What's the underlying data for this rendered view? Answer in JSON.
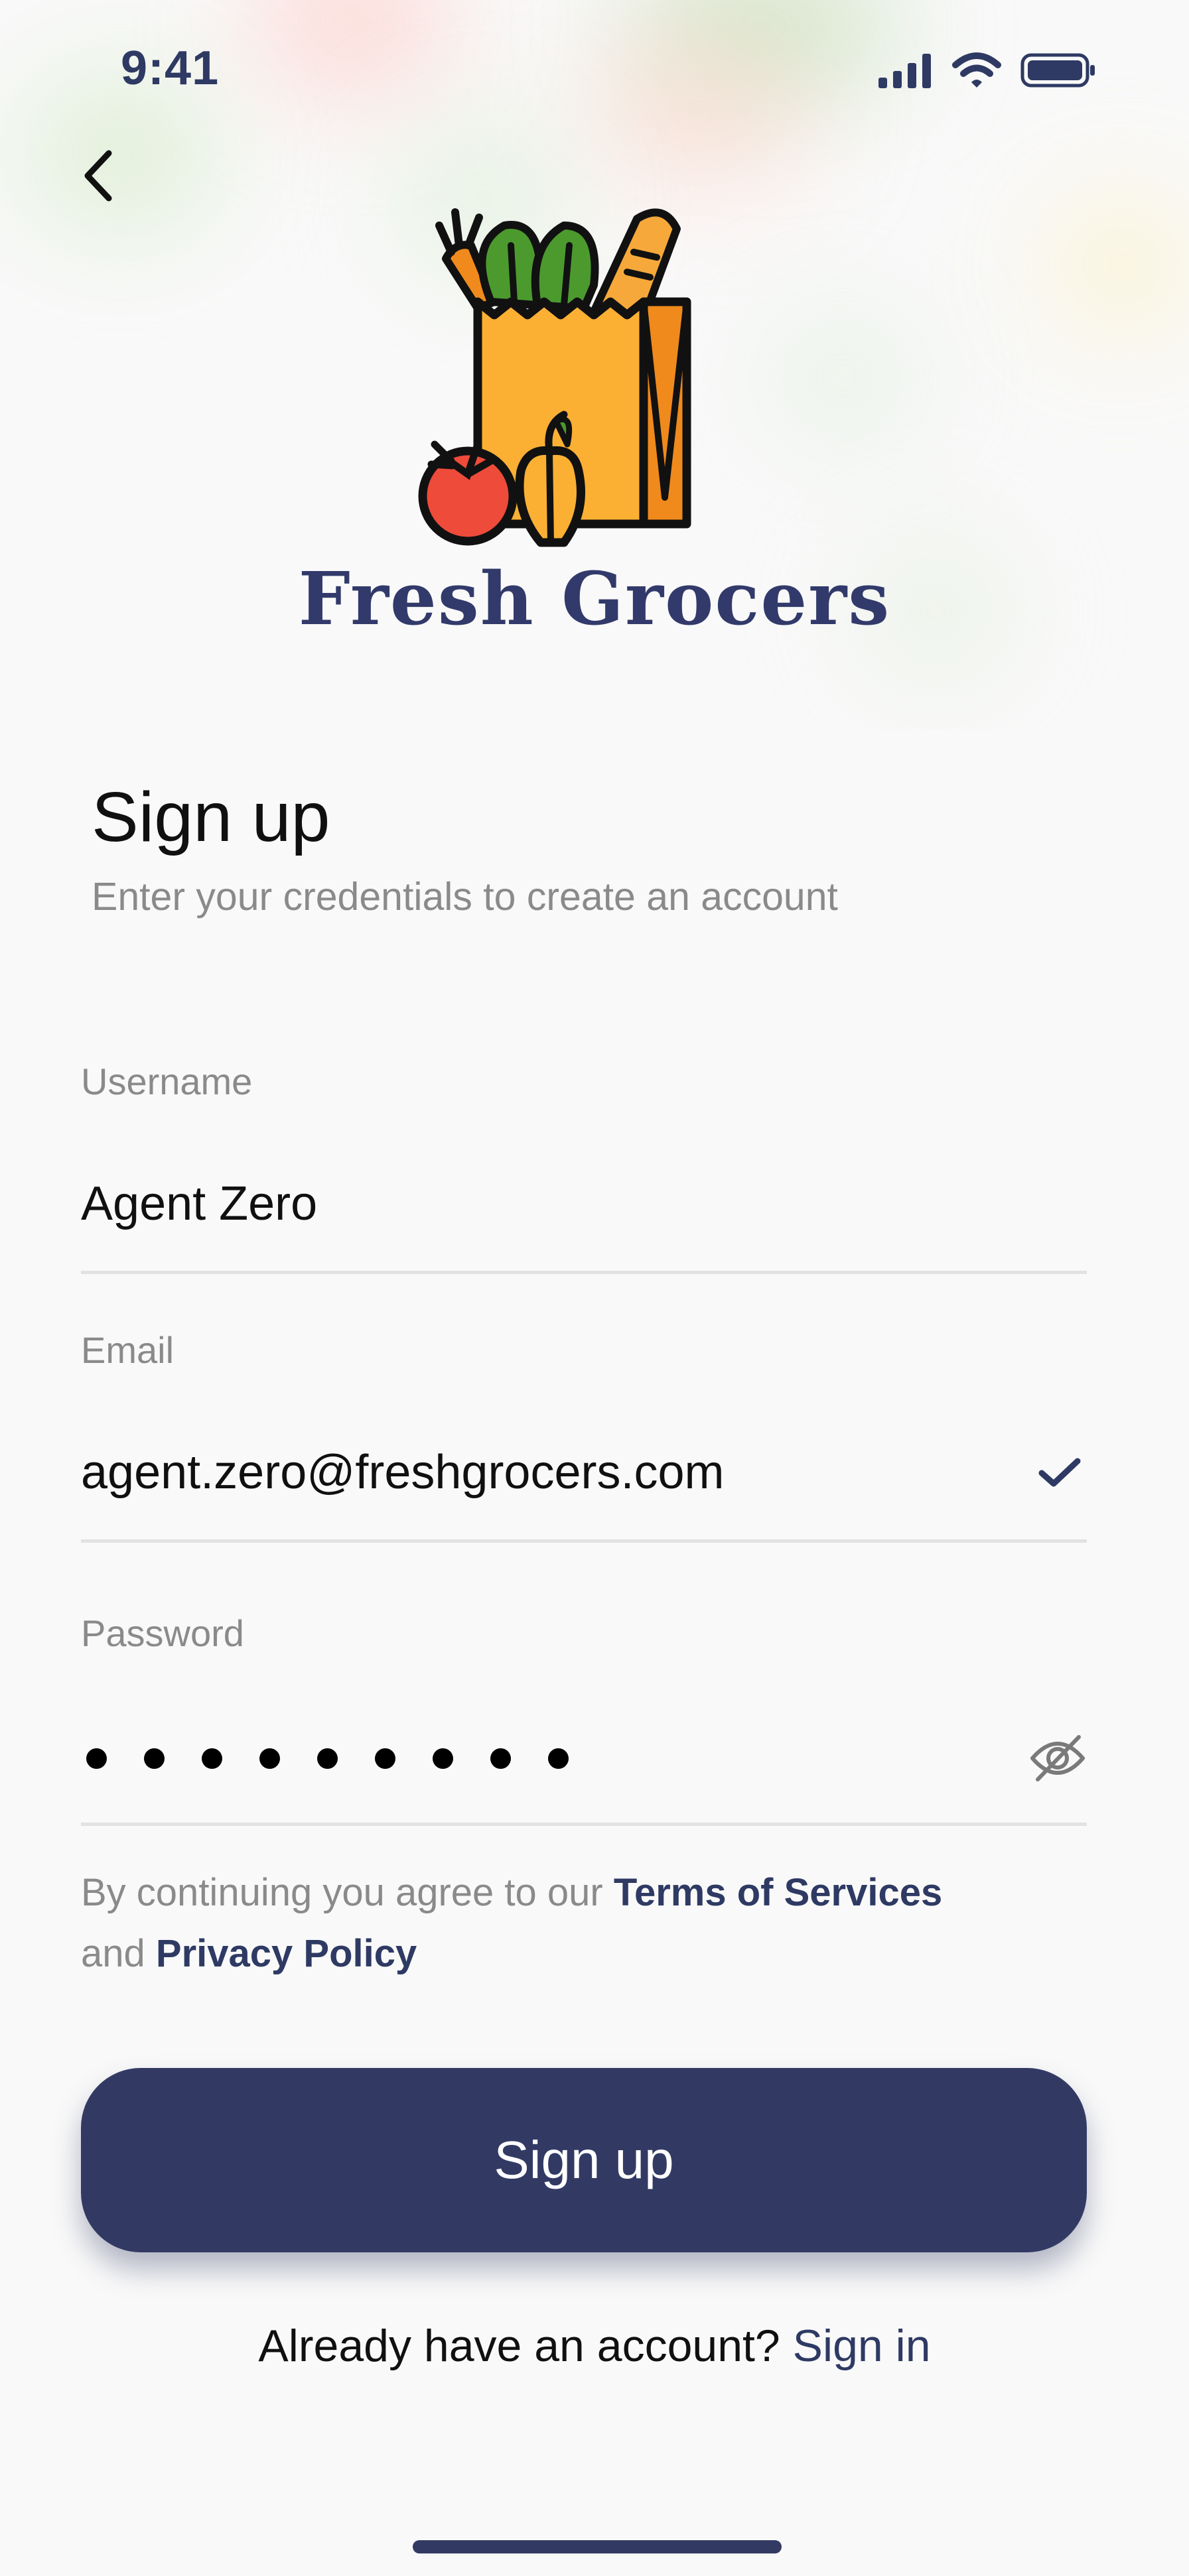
{
  "status_bar": {
    "time": "9:41"
  },
  "brand": {
    "name": "Fresh Grocers"
  },
  "form": {
    "title": "Sign up",
    "subtitle": "Enter your credentials to create an account",
    "username": {
      "label": "Username",
      "value": "Agent Zero"
    },
    "email": {
      "label": "Email",
      "value": "agent.zero@freshgrocers.com",
      "valid": true
    },
    "password": {
      "label": "Password",
      "masked_length": 9,
      "visible": false
    },
    "terms": {
      "prefix": "By continuing you agree to our ",
      "terms_link": "Terms of Services",
      "middle": "and ",
      "privacy_link": "Privacy Policy"
    },
    "submit_label": "Sign up",
    "signin_prompt": "Already have an account? ",
    "signin_link": "Sign in"
  },
  "icons": [
    "back-chevron-icon",
    "signal-icon",
    "wifi-icon",
    "battery-icon",
    "check-icon",
    "eye-off-icon",
    "grocery-bag-logo"
  ],
  "colors": {
    "primary": "#323a64",
    "muted_text": "#8a8a8a",
    "background": "#f9f9f9"
  }
}
